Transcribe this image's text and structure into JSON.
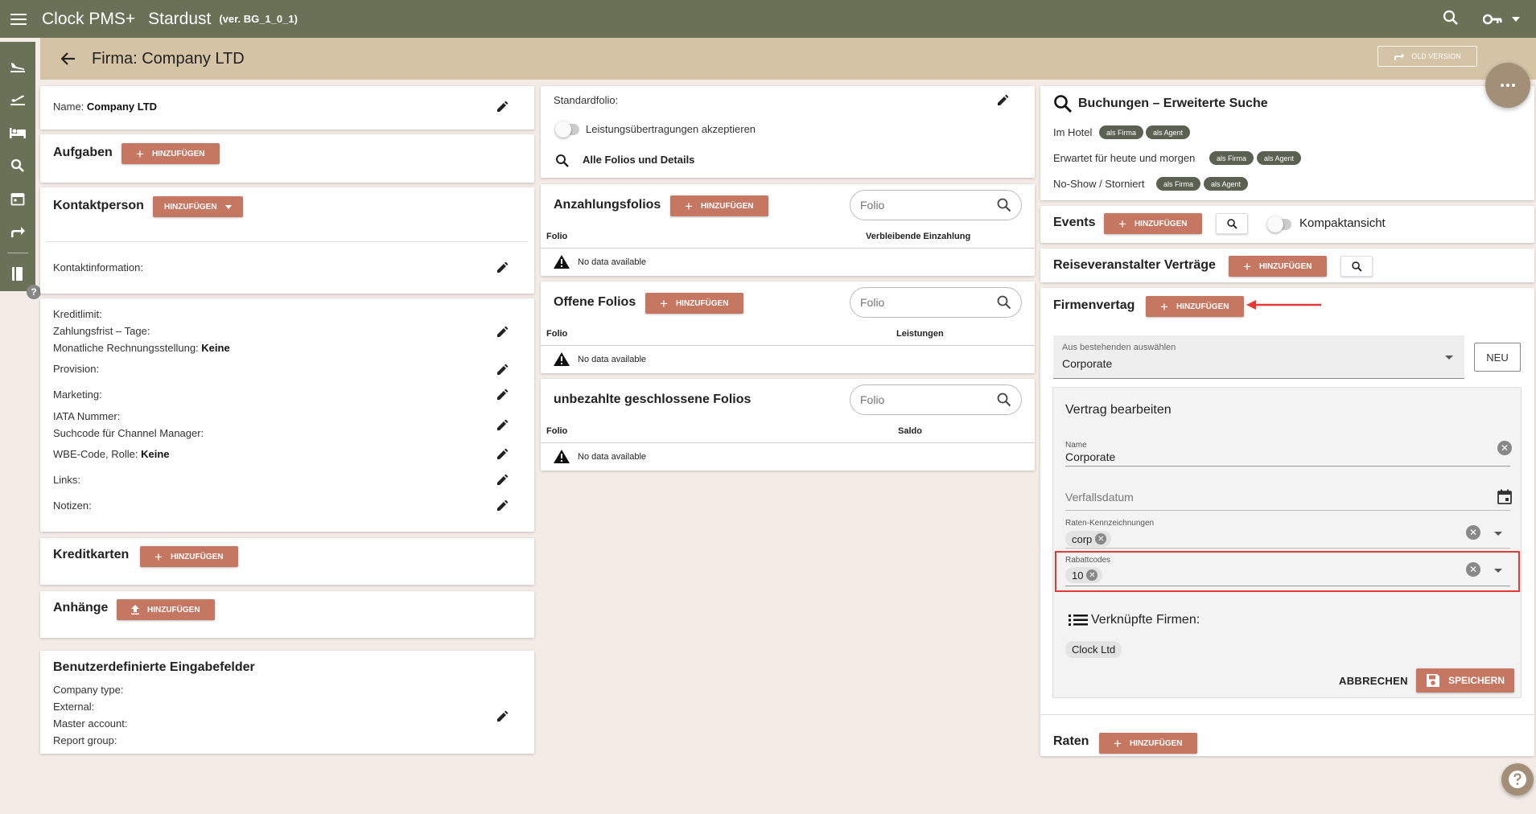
{
  "app": {
    "name": "Clock PMS+",
    "hotel": "Stardust",
    "version": "(ver. BG_1_0_1)"
  },
  "page": {
    "title": "Firma: Company LTD",
    "old_version_label": "OLD VERSION"
  },
  "left": {
    "name_label": "Name:",
    "name_value": "Company LTD",
    "tasks_title": "Aufgaben",
    "add_label": "HINZUFÜGEN",
    "contact_title": "Kontaktperson",
    "contact_info_label": "Kontaktinformation:",
    "credit_limit": "Kreditlimit:",
    "payment_term": "Zahlungsfrist – Tage:",
    "monthly_billing_label": "Monatliche Rechnungsstellung:",
    "monthly_billing_value": "Keine",
    "commission": "Provision:",
    "marketing": "Marketing:",
    "iata": "IATA Nummer:",
    "channel_search": "Suchcode für Channel Manager:",
    "wbe_label": "WBE-Code, Rolle:",
    "wbe_value": "Keine",
    "links": "Links:",
    "notes": "Notizen:",
    "cards_title": "Kreditkarten",
    "attachments_title": "Anhänge",
    "custom_title": "Benutzerdefinierte Eingabefelder",
    "company_type": "Company type:",
    "external": "External:",
    "master_account": "Master account:",
    "report_group": "Report group:"
  },
  "middle": {
    "standard_folio": "Standardfolio:",
    "accept_transfers": "Leistungsübertragungen akzeptieren",
    "all_folios": "Alle Folios und Details",
    "deposit_title": "Anzahlungsfolios",
    "open_title": "Offene Folios",
    "unpaid_title": "unbezahlte geschlossene Folios",
    "search_placeholder": "Folio",
    "col_folio": "Folio",
    "col_remaining": "Verbleibende Einzahlung",
    "col_services": "Leistungen",
    "col_balance": "Saldo",
    "no_data": "No data available"
  },
  "right": {
    "bookings_title": "Buchungen – Erweiterte Suche",
    "in_hotel": "Im Hotel",
    "expected_today": "Erwartet für heute und morgen",
    "noshow": "No-Show / Storniert",
    "as_company": "als Firma",
    "as_agent": "als Agent",
    "events_title": "Events",
    "compact_view": "Kompaktansicht",
    "tour_title": "Reiseveranstalter Verträge",
    "contract_title": "Firmenvertag",
    "select_existing_label": "Aus bestehenden auswählen",
    "select_existing_value": "Corporate",
    "new_label": "NEU",
    "edit_title": "Vertrag bearbeiten",
    "name_label": "Name",
    "name_value": "Corporate",
    "due_date_placeholder": "Verfallsdatum",
    "rate_codes_label": "Raten-Kennzeichnungen",
    "rate_code_chip": "corp",
    "discount_label": "Rabattcodes",
    "discount_chip": "10",
    "linked_title": "Verknüpfte Firmen:",
    "linked_chip": "Clock Ltd",
    "cancel_label": "ABBRECHEN",
    "save_label": "SPEICHERN",
    "rates_title": "Raten"
  },
  "colors": {
    "topbar": "#6b7157",
    "header": "#d4c4a5",
    "accent_button": "#c57762",
    "chip": "#5b6150",
    "highlight_border": "#e53935"
  }
}
